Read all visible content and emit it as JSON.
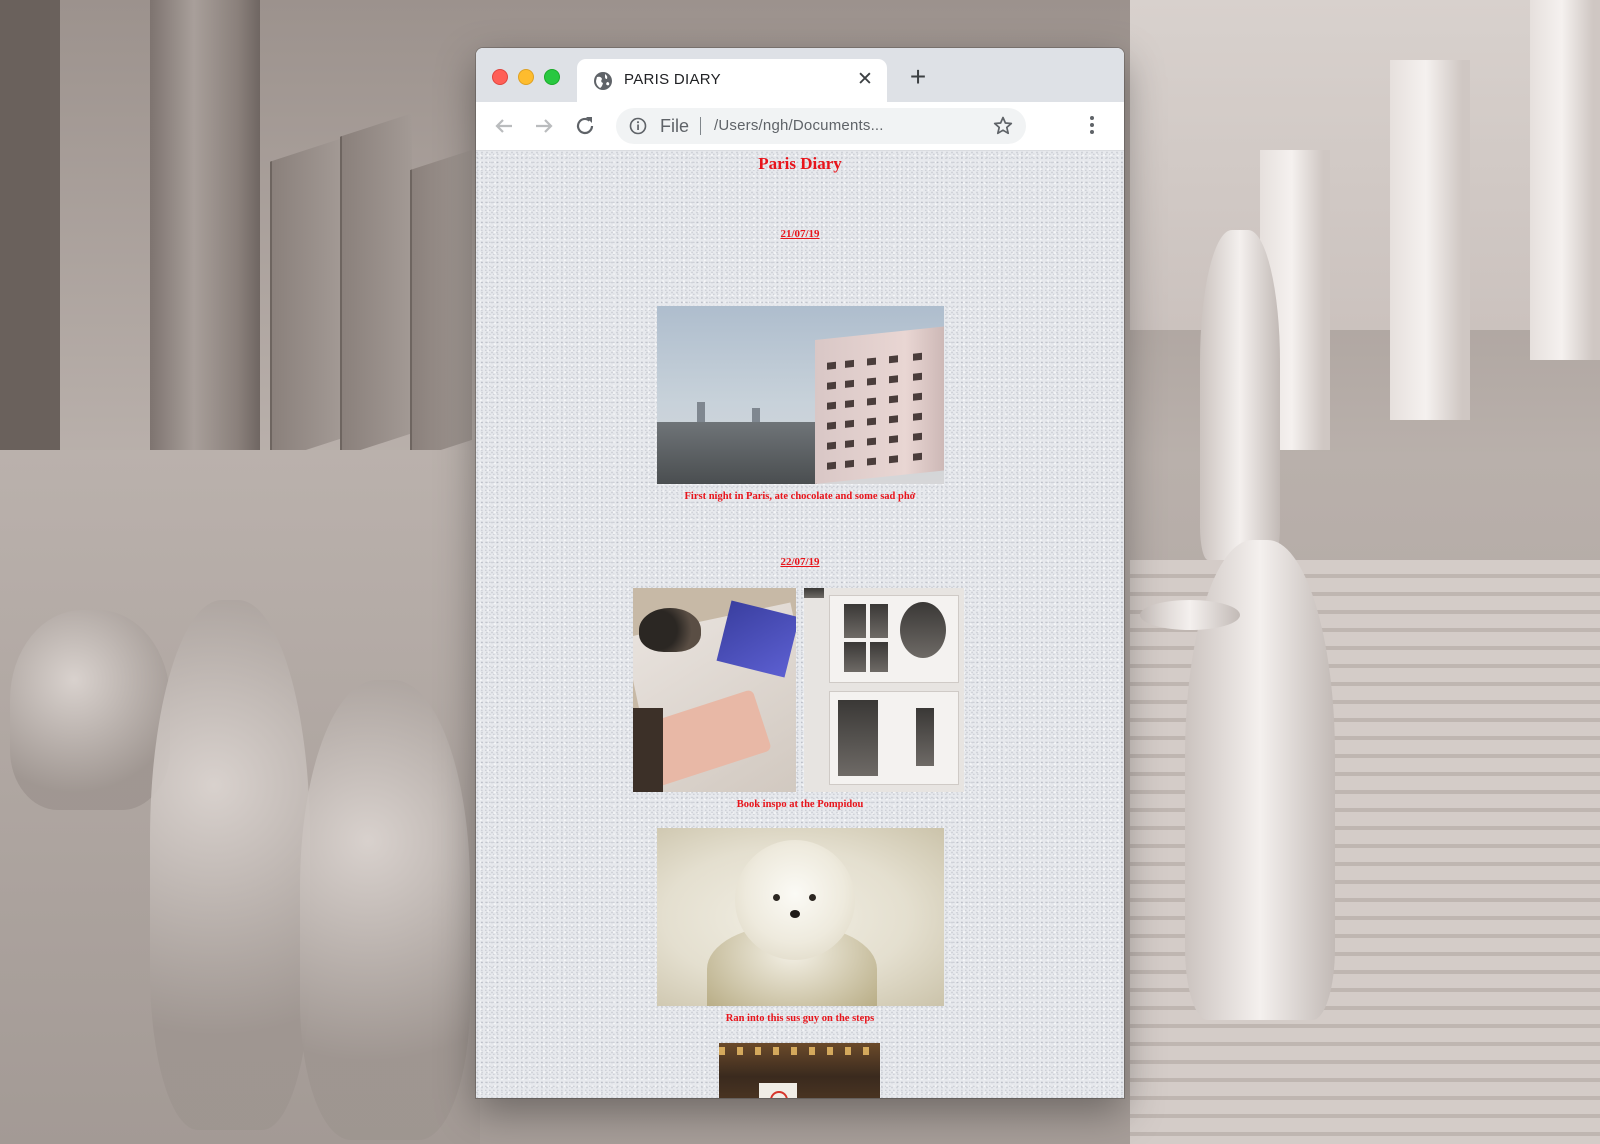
{
  "browser": {
    "tab_title": "PARIS DIARY",
    "tab_close": "✕",
    "new_tab": "+",
    "scheme_label": "File",
    "url": "/Users/ngh/Documents..."
  },
  "page": {
    "title": "Paris Diary",
    "entries": [
      {
        "date": "21/07/19",
        "photos": [
          {
            "caption": "First night in Paris, ate chocolate and some sad phở"
          }
        ]
      },
      {
        "date": "22/07/19",
        "photos": [
          {
            "caption": "Book inspo at the Pompidou"
          },
          {
            "caption": "Ran into this sus guy on the steps"
          }
        ]
      }
    ]
  },
  "colors": {
    "accent_red": "#e8141b",
    "page_bg": "#e7e9ed",
    "chrome_tabbar": "#dee1e6"
  },
  "icons": {
    "tab_favicon": "globe-icon",
    "back": "arrow-left-icon",
    "forward": "arrow-right-icon",
    "reload": "reload-icon",
    "site_info": "info-icon",
    "bookmark": "star-icon",
    "menu": "kebab-menu-icon"
  }
}
